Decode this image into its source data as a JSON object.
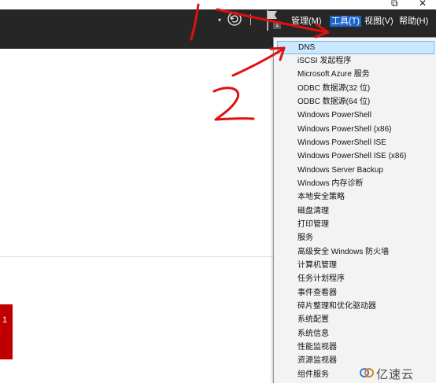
{
  "window": {
    "restore_glyph": "⧉",
    "close_glyph": "✕"
  },
  "toolbar": {
    "dropdown_arrow_glyph": "▾",
    "refresh_icon": "refresh-icon",
    "flag_icon": "flag-icon",
    "flag_badge": "1",
    "menu": {
      "manage": "管理(M)",
      "tools": "工具(T)",
      "view": "视图(V)",
      "help": "帮助(H)"
    },
    "active_color": "#1e64c8",
    "background_color": "#262626"
  },
  "tile": {
    "label": "1",
    "color": "#c00000"
  },
  "tools_menu": {
    "items": [
      "DNS",
      "iSCSI 发起程序",
      "Microsoft Azure 服务",
      "ODBC 数据源(32 位)",
      "ODBC 数据源(64 位)",
      "Windows PowerShell",
      "Windows PowerShell (x86)",
      "Windows PowerShell ISE",
      "Windows PowerShell ISE (x86)",
      "Windows Server Backup",
      "Windows 内存诊断",
      "本地安全策略",
      "磁盘清理",
      "打印管理",
      "服务",
      "高级安全 Windows 防火墙",
      "计算机管理",
      "任务计划程序",
      "事件查看器",
      "碎片整理和优化驱动器",
      "系统配置",
      "系统信息",
      "性能监视器",
      "资源监视器",
      "组件服务"
    ],
    "highlight_color": "#cce8ff"
  },
  "annotations": {
    "color": "#e01010"
  },
  "watermark": {
    "text": "亿速云"
  }
}
